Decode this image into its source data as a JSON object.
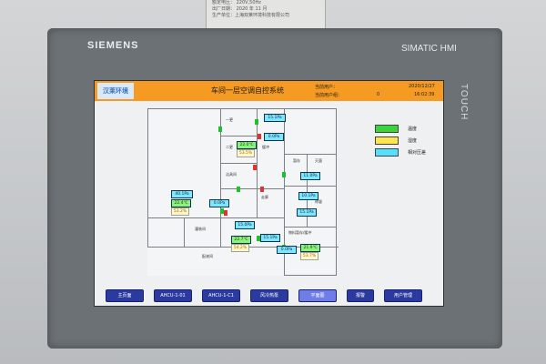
{
  "nameplate": {
    "line1": "额定电压：  220V,50Hz",
    "line2": "出厂日期：  2020 年 11 月",
    "line3": "生产单位：上海双莱环境科技有限公司"
  },
  "hmi": {
    "brand": "SIEMENS",
    "model": "SIMATIC HMI",
    "touch": "TOUCH"
  },
  "header": {
    "logo_text": "汉莱环境",
    "title": "车间一层空调自控系统",
    "user_label": "当前用户：",
    "user_group_label": "当前用户组：",
    "user_group_value": "0",
    "date": "2020/12/27",
    "time": "16:02:39"
  },
  "legend": [
    {
      "color": "#39d43a",
      "label": "温度"
    },
    {
      "color": "#ffe44b",
      "label": "湿度"
    },
    {
      "color": "#53e0ff",
      "label": "相对压差"
    }
  ],
  "plan": {
    "rooms": [
      {
        "label": "一更"
      },
      {
        "label": "二更"
      },
      {
        "label": "缓冲"
      },
      {
        "label": "洁具间"
      },
      {
        "label": "配液间"
      },
      {
        "label": "灌装间"
      },
      {
        "label": "暂存"
      },
      {
        "label": "灭菌"
      },
      {
        "label": "称量"
      },
      {
        "label": "物料暂存/缓冲"
      },
      {
        "label": "走廊"
      }
    ],
    "readings": {
      "p1": "15.1Pa",
      "p2": "0.0Pa",
      "t1": "22.0℃",
      "h1": "53.5%",
      "p3": "11.0Pa",
      "p4": "10.1Pa",
      "p5": "15.1Pa",
      "p6": "40.1Pa",
      "t2": "22.4℃",
      "h2": "53.2%",
      "p7": "0.0Pa",
      "p8": "15.0Pa",
      "t3": "22.7℃",
      "h3": "54.2%",
      "p9": "15.1Pa",
      "p10": "0.0Pa",
      "t4": "21.9℃",
      "h4": "53.7%"
    }
  },
  "nav": [
    {
      "label": "主页面",
      "active": false
    },
    {
      "label": "AHCU-1-01",
      "active": false
    },
    {
      "label": "AHCU-1-C1",
      "active": false
    },
    {
      "label": "风冷热泵",
      "active": false
    },
    {
      "label": "平面图",
      "active": true
    },
    {
      "label": "报警",
      "active": false
    },
    {
      "label": "用户管理",
      "active": false
    }
  ]
}
